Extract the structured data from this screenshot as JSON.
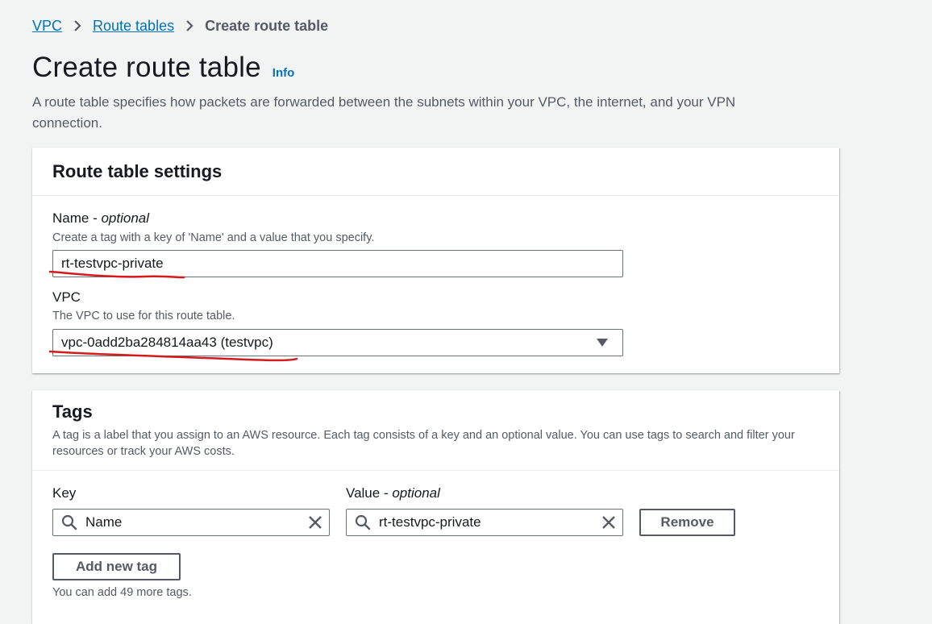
{
  "breadcrumb": {
    "items": [
      "VPC",
      "Route tables"
    ],
    "current": "Create route table"
  },
  "page": {
    "title": "Create route table",
    "info_label": "Info",
    "description": "A route table specifies how packets are forwarded between the subnets within your VPC, the internet, and your VPN connection."
  },
  "settings": {
    "heading": "Route table settings",
    "name_label": "Name",
    "name_optional": "optional",
    "name_hint": "Create a tag with a key of 'Name' and a value that you specify.",
    "name_value": "rt-testvpc-private",
    "vpc_label": "VPC",
    "vpc_hint": "The VPC to use for this route table.",
    "vpc_value": "vpc-0add2ba284814aa43 (testvpc)"
  },
  "tags": {
    "heading": "Tags",
    "description": "A tag is a label that you assign to an AWS resource. Each tag consists of a key and an optional value. You can use tags to search and filter your resources or track your AWS costs.",
    "key_label": "Key",
    "value_label": "Value",
    "value_optional": "optional",
    "rows": [
      {
        "key": "Name",
        "value": "rt-testvpc-private"
      }
    ],
    "remove_label": "Remove",
    "add_label": "Add new tag",
    "footnote": "You can add 49 more tags."
  },
  "colors": {
    "link": "#0073bb",
    "annotation": "#d41b1b",
    "background": "#f2f3f3"
  },
  "icons": [
    "chevron-right-icon",
    "search-icon",
    "clear-icon",
    "caret-down-icon"
  ]
}
